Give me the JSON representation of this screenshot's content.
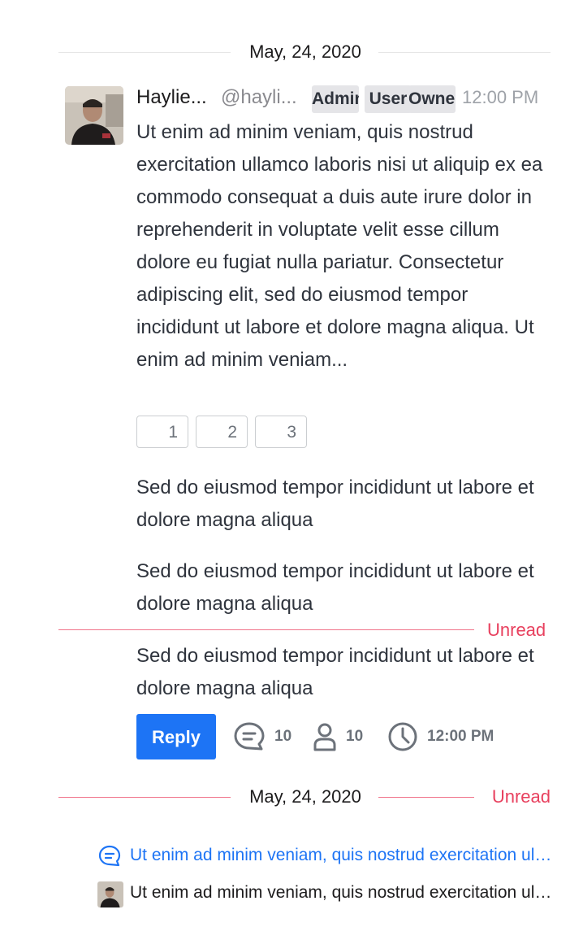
{
  "date_divider_1": {
    "date": "May, 24, 2020"
  },
  "message": {
    "author_name": "Haylie...",
    "author_handle": "@hayli...",
    "roles": [
      "Admin",
      "User",
      "Owner"
    ],
    "time": "12:00 PM",
    "body": "Ut enim ad minim veniam, quis nostrud exercitation ullamco laboris nisi ut aliquip ex ea commodo consequat a duis aute irure dolor in reprehenderit in voluptate velit esse cillum dolore eu fugiat nulla pariatur. Consectetur adipiscing elit, sed do eiusmod tempor incididunt ut labore et dolore magna aliqua. Ut enim ad minim veniam...",
    "reactions": [
      {
        "count": "1"
      },
      {
        "count": "2"
      },
      {
        "count": "3"
      }
    ]
  },
  "follow_ups": [
    "Sed do eiusmod tempor incididunt ut labore et dolore magna aliqua",
    "Sed do eiusmod tempor incididunt ut labore et dolore magna aliqua",
    "Sed do eiusmod tempor incididunt ut labore et dolore magna aliqua"
  ],
  "unread_label": "Unread",
  "thread_actions": {
    "reply_label": "Reply",
    "replies_count": "10",
    "participants_count": "10",
    "last_time": "12:00 PM"
  },
  "date_divider_2": {
    "date": "May, 24, 2020",
    "unread_label": "Unread"
  },
  "thread_preview": {
    "text": "Ut enim ad minim veniam, quis nostrud exercitation ullamco laboris nisi ut aliquip"
  },
  "last_reply": {
    "text": "Ut enim ad minim veniam, quis nostrud exercitation ullamco laboris nisi ut aliquip"
  },
  "colors": {
    "accent": "#1d74f5",
    "unread": "#e8405e",
    "unread_line": "#f0738a"
  },
  "icons": {
    "replies": "thread-bubble-icon",
    "participants": "user-icon",
    "time": "clock-icon"
  }
}
